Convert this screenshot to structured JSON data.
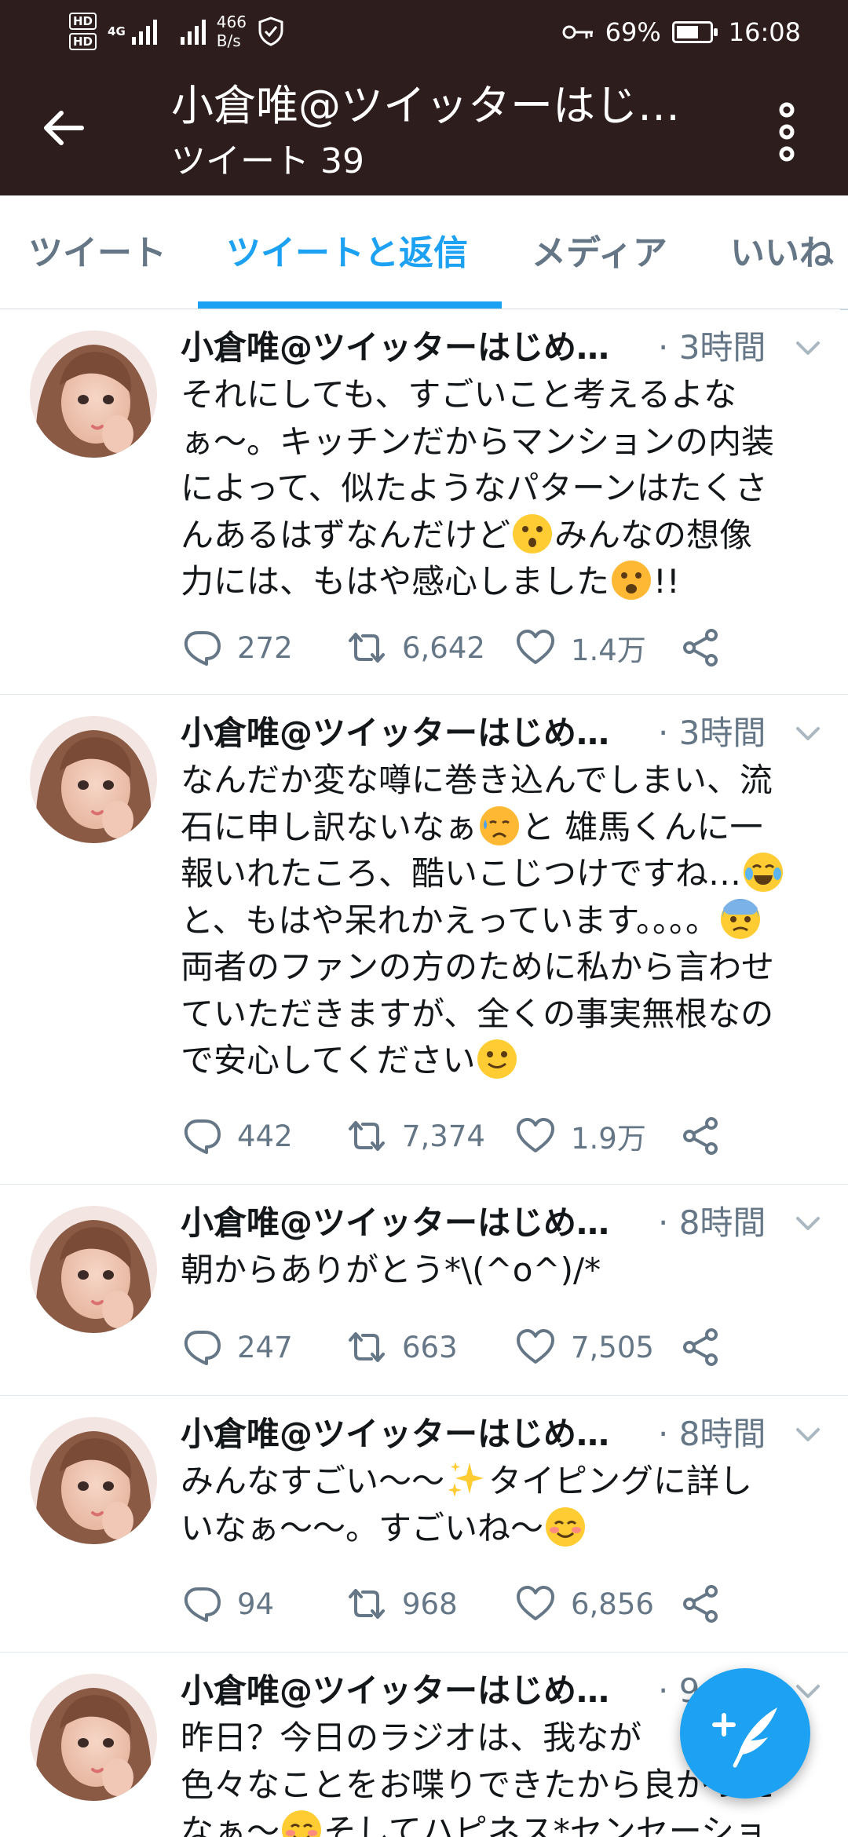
{
  "status_bar": {
    "hd1": "HD",
    "hd2": "HD",
    "network": "4G",
    "speed_value": "466",
    "speed_unit": "B/s",
    "battery": "69%",
    "time": "16:08"
  },
  "header": {
    "title": "小倉唯@ツイッターはじ…",
    "subtitle": "ツイート 39"
  },
  "tabs": [
    {
      "label": "ツイート",
      "active": false
    },
    {
      "label": "ツイートと返信",
      "active": true
    },
    {
      "label": "メディア",
      "active": false
    },
    {
      "label": "いいね",
      "active": false
    }
  ],
  "tweets": [
    {
      "name": "小倉唯@ツイッターはじめ…",
      "time": "· 3時間",
      "body": [
        "それにしても、すごいこと考えるよな",
        "ぁ〜。キッチンだからマンションの内装",
        "によって、似たようなパターンはたくさ",
        "んあるはずなんだけど",
        "みんなの想像",
        "力には、もはや感心しました",
        "!!"
      ],
      "replies": "272",
      "retweets": "6,642",
      "likes": "1.4万"
    },
    {
      "name": "小倉唯@ツイッターはじめ…",
      "time": "· 3時間",
      "body": [
        "なんだか変な噂に巻き込んでしまい、流",
        "石に申し訳ないなぁ",
        "と 雄馬くんに一",
        "報いれたころ、酷いこじつけですね…",
        "と、もはや呆れかえっています。。。。",
        "両者のファンの方のために私から言わせ",
        "ていただきますが、全くの事実無根なの",
        "で安心してください"
      ],
      "replies": "442",
      "retweets": "7,374",
      "likes": "1.9万"
    },
    {
      "name": "小倉唯@ツイッターはじめ…",
      "time": "· 8時間",
      "body": [
        "朝からありがとう*\\(^o^)/*"
      ],
      "replies": "247",
      "retweets": "663",
      "likes": "7,505"
    },
    {
      "name": "小倉唯@ツイッターはじめ…",
      "time": "· 8時間",
      "body": [
        "みんなすごい〜〜",
        "タイピングに詳し",
        "いなぁ〜〜。すごいね〜"
      ],
      "replies": "94",
      "retweets": "968",
      "likes": "6,856"
    },
    {
      "name": "小倉唯@ツイッターはじめ…",
      "time": "· 9",
      "body": [
        "昨日？今日のラジオは、我なが",
        "色々なことをお喋りできたから良かった",
        "なぁ〜",
        "そしてハピネス*センセーショ"
      ]
    }
  ],
  "colors": {
    "header_bg": "#2d1d1c",
    "accent": "#1da1f2",
    "secondary_text": "#657786"
  },
  "icons": [
    "back-arrow-icon",
    "more-vert-icon",
    "reply-icon",
    "retweet-icon",
    "like-icon",
    "share-icon",
    "chevron-down-icon",
    "compose-tweet-icon"
  ]
}
